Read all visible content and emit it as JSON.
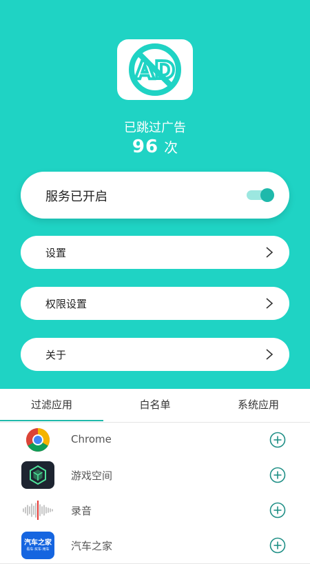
{
  "header": {
    "logo_icon": "ad-block-icon",
    "logo_text": "AD",
    "skip_label": "已跳过广告",
    "skip_count": "96",
    "skip_unit": "次"
  },
  "service": {
    "label": "服务已开启",
    "enabled": true
  },
  "menu": {
    "items": [
      {
        "label": "设置",
        "icon": "chevron-right-icon"
      },
      {
        "label": "权限设置",
        "icon": "chevron-right-icon"
      },
      {
        "label": "关于",
        "icon": "chevron-right-icon"
      }
    ]
  },
  "tabs": {
    "items": [
      {
        "label": "过滤应用",
        "active": true
      },
      {
        "label": "白名单",
        "active": false
      },
      {
        "label": "系统应用",
        "active": false
      }
    ]
  },
  "apps": {
    "items": [
      {
        "name": "Chrome",
        "icon": "chrome-icon",
        "action_icon": "add-circle-icon"
      },
      {
        "name": "游戏空间",
        "icon": "game-space-icon",
        "action_icon": "add-circle-icon"
      },
      {
        "name": "录音",
        "icon": "sound-wave-icon",
        "action_icon": "add-circle-icon"
      },
      {
        "name": "汽车之家",
        "icon": "autohome-icon",
        "icon_text": "汽车之家",
        "icon_subtext": "看车·买车·用车",
        "action_icon": "add-circle-icon"
      }
    ]
  },
  "colors": {
    "accent": "#1fd3c4",
    "accent_dark": "#1fb9ab"
  }
}
